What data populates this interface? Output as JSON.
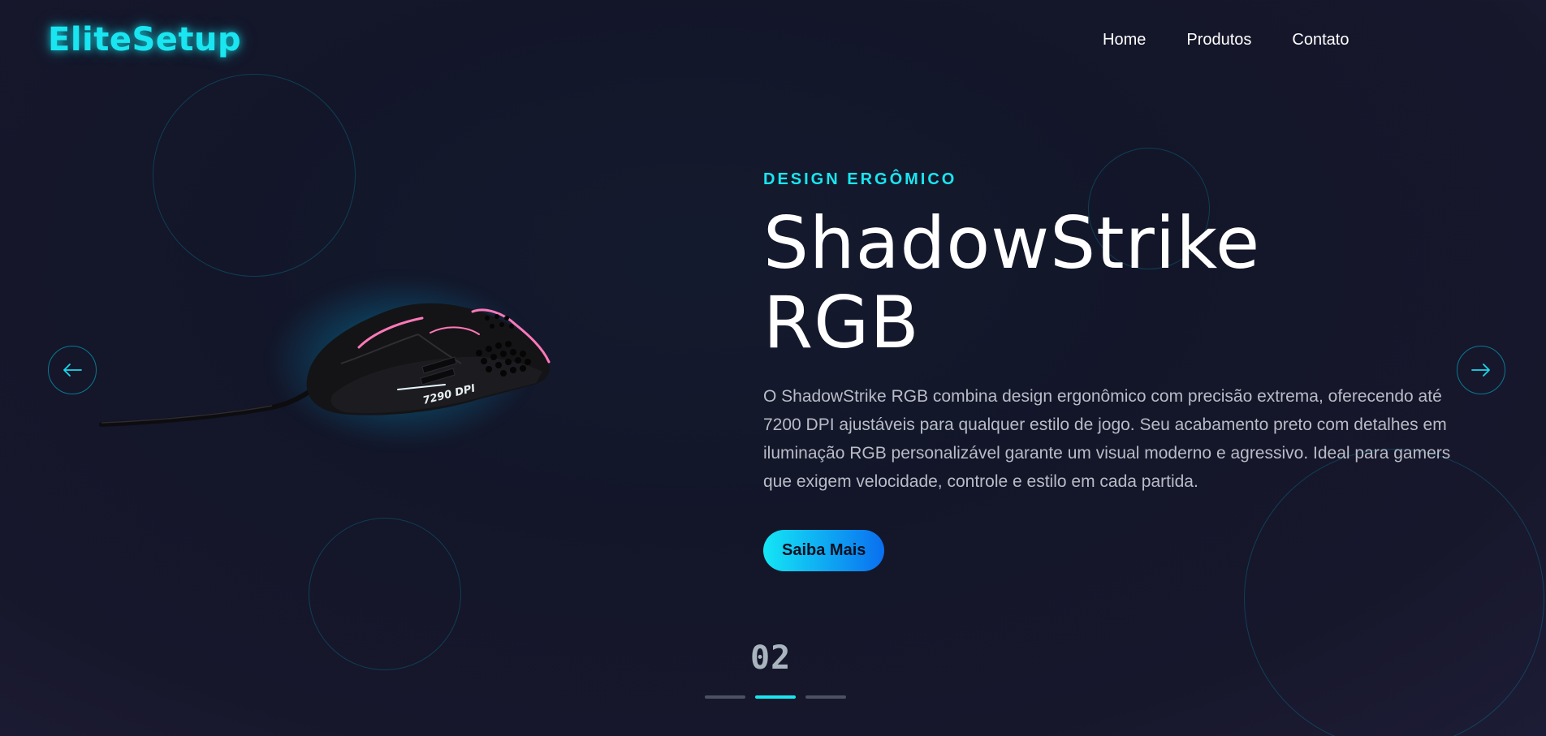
{
  "brand": {
    "logo_text": "EliteSetup",
    "accent_color": "#19e6f0"
  },
  "nav": {
    "items": [
      "Home",
      "Produtos",
      "Contato"
    ]
  },
  "carousel": {
    "prev_icon": "arrow-left-icon",
    "next_icon": "arrow-right-icon",
    "current_slide": "02",
    "active_index": 1,
    "slide_count": 3
  },
  "product": {
    "image": "gaming-mouse",
    "dpi_label": "7290 DPI"
  },
  "hero": {
    "eyebrow": "DESIGN ERGÔMICO",
    "title_line1": "ShadowStrike",
    "title_line2": "RGB",
    "description": "O ShadowStrike RGB combina design ergonômico com precisão extrema, oferecendo até 7200 DPI ajustáveis para qualquer estilo de jogo. Seu acabamento preto com detalhes em iluminação RGB personalizável garante um visual moderno e agressivo. Ideal para gamers que exigem velocidade, controle e estilo em cada partida.",
    "cta_label": "Saiba Mais"
  }
}
